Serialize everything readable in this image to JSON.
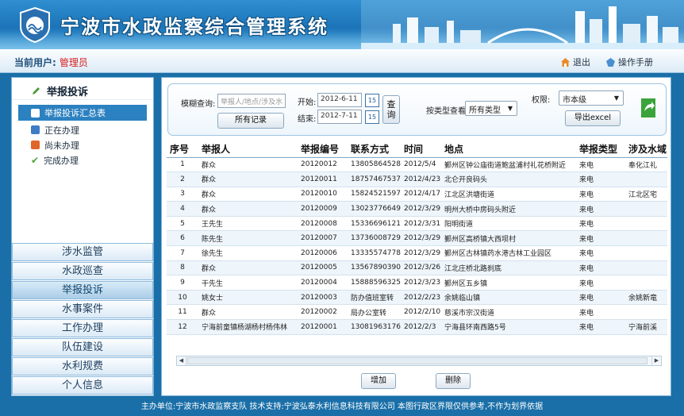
{
  "header": {
    "app_title": "宁波市水政监察综合管理系统"
  },
  "userbar": {
    "current_user_label": "当前用户:",
    "current_user": "管理员",
    "logout_label": "退出",
    "manual_label": "操作手册"
  },
  "sidebar": {
    "menu_title": "举报投诉",
    "sub_items": [
      "举报投诉汇总表",
      "正在办理",
      "尚未办理",
      "完成办理"
    ],
    "nav_items": [
      "涉水监管",
      "水政巡查",
      "举报投诉",
      "水事案件",
      "工作办理",
      "队伍建设",
      "水利规费",
      "个人信息"
    ],
    "active_nav": "举报投诉"
  },
  "filter": {
    "fuzzy_label": "模糊查询:",
    "fuzzy_placeholder": "举报人/地点/涉及水",
    "all_records_button": "所有记录",
    "start_label": "开始:",
    "start_value": "2012-6-11",
    "end_label": "结束:",
    "end_value": "2012-7-11",
    "cal_day": "15",
    "query_button": "查询",
    "type_label": "按类型查看:",
    "type_value": "所有类型",
    "permission_label": "权限:",
    "permission_value": "市本级",
    "export_button": "导出excel"
  },
  "table": {
    "columns": [
      "序号",
      "举报人",
      "举报编号",
      "联系方式",
      "时间",
      "地点",
      "举报类型",
      "涉及水域"
    ],
    "rows": [
      [
        "1",
        "群众",
        "20120012",
        "13805864528",
        "2012/5/4",
        "鄞州区钟公庙街道鲍盆浦村礼花桥附近",
        "来电",
        "奉化江礼"
      ],
      [
        "2",
        "群众",
        "20120011",
        "18757467537",
        "2012/4/23",
        "北仑开良码头",
        "来电",
        ""
      ],
      [
        "3",
        "群众",
        "20120010",
        "15824521597",
        "2012/4/17",
        "江北区洪塘街道",
        "来电",
        "江北区宅"
      ],
      [
        "4",
        "群众",
        "20120009",
        "13023776649",
        "2012/3/29",
        "明州大桥中房码头附近",
        "来电",
        ""
      ],
      [
        "5",
        "王先生",
        "20120008",
        "15336696121",
        "2012/3/31",
        "阳明街道",
        "来电",
        ""
      ],
      [
        "6",
        "陈先生",
        "20120007",
        "13736008729",
        "2012/3/29",
        "鄞州区高桥镇大西坝村",
        "来电",
        ""
      ],
      [
        "7",
        "徐先生",
        "20120006",
        "13335574778",
        "2012/3/29",
        "鄞州区古林镇药水港古林工业园区",
        "来电",
        ""
      ],
      [
        "8",
        "群众",
        "20120005",
        "13567890390",
        "2012/3/26",
        "江北庄桥北路刹底",
        "来电",
        ""
      ],
      [
        "9",
        "干先生",
        "20120004",
        "15888596325",
        "2012/3/23",
        "鄞州区五乡镇",
        "来电",
        ""
      ],
      [
        "10",
        "姚女士",
        "20120003",
        "防办值班室转",
        "2012/2/23",
        "余姚临山镇",
        "来电",
        "余姚新竜"
      ],
      [
        "11",
        "群众",
        "20120002",
        "局办公室转",
        "2012/2/10",
        "慈溪市宗汉街道",
        "来电",
        ""
      ],
      [
        "12",
        "宁海前童镇杨湖杨村杨伟林",
        "20120001",
        "13081963176",
        "2012/2/3",
        "宁海县环南西路5号",
        "来电",
        "宁海前溪"
      ]
    ]
  },
  "actions": {
    "add_button": "增加",
    "delete_button": "删除"
  },
  "footer": {
    "text": "主办单位:宁波市水政监察支队   技术支持:宁波弘泰水利信息科技有限公司   本图行政区界限仅供参考,不作为划界依据"
  },
  "colors": {
    "brand_blue": "#1c74b8",
    "active_red": "#d81e1e",
    "export_green": "#3aa33a"
  }
}
